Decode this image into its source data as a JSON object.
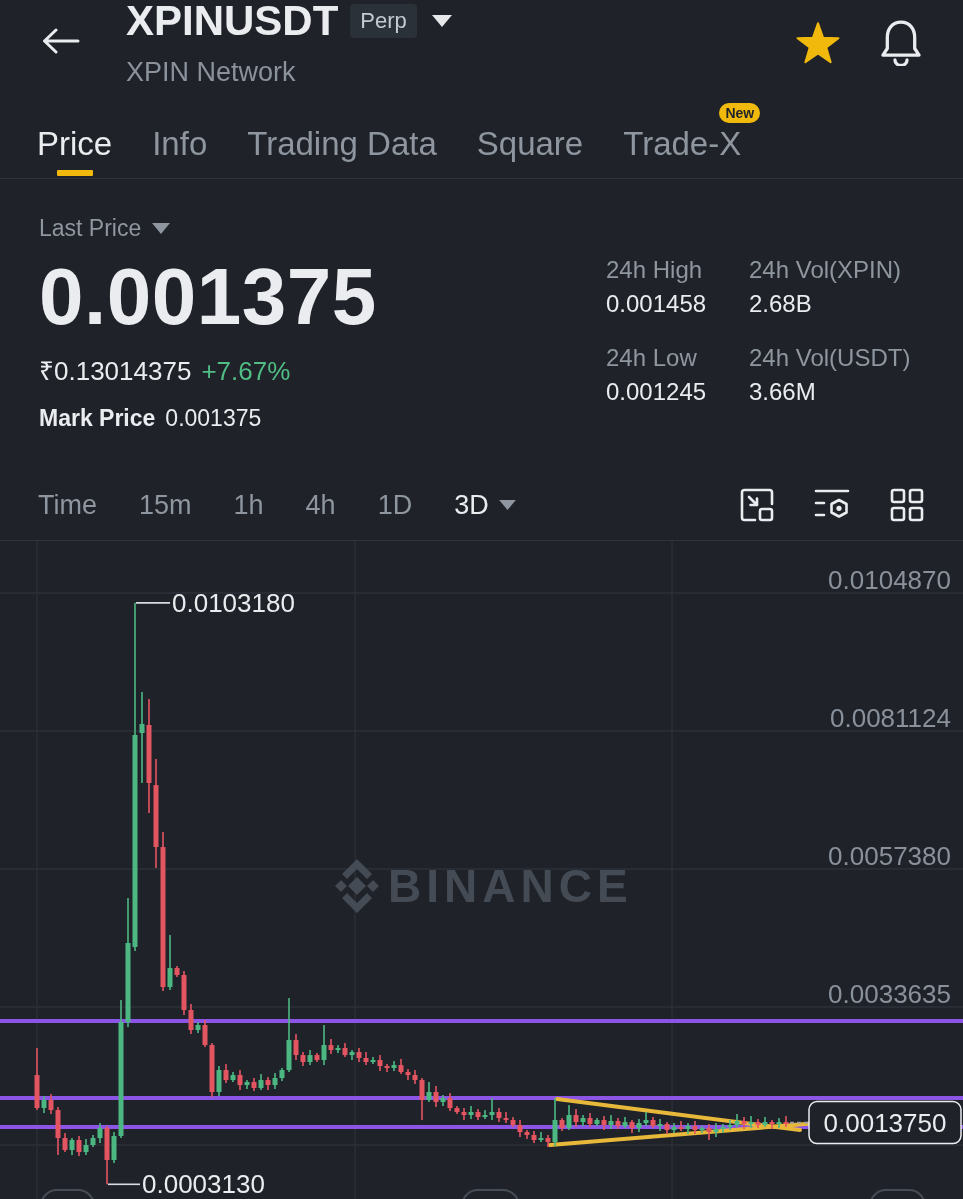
{
  "header": {
    "title": "XPINUSDT",
    "badge": "Perp",
    "subtitle": "XPIN Network",
    "favorite": true
  },
  "tabs": [
    {
      "label": "Price",
      "selected": true
    },
    {
      "label": "Info",
      "selected": false
    },
    {
      "label": "Trading Data",
      "selected": false
    },
    {
      "label": "Square",
      "selected": false
    },
    {
      "label": "Trade-X",
      "selected": false,
      "badge": "New"
    }
  ],
  "price": {
    "label": "Last Price",
    "value": "0.001375",
    "fiat": "₹0.13014375",
    "change": "+7.67%",
    "positive": true,
    "mark_label": "Mark Price",
    "mark_value": "0.001375"
  },
  "stats": [
    {
      "label": "24h High",
      "value": "0.001458"
    },
    {
      "label": "24h Vol(XPIN)",
      "value": "2.68B"
    },
    {
      "label": "24h Low",
      "value": "0.001245"
    },
    {
      "label": "24h Vol(USDT)",
      "value": "3.66M"
    }
  ],
  "intervals": [
    {
      "label": "Time",
      "selected": false,
      "dropdown": false
    },
    {
      "label": "15m",
      "selected": false,
      "dropdown": false
    },
    {
      "label": "1h",
      "selected": false,
      "dropdown": false
    },
    {
      "label": "4h",
      "selected": false,
      "dropdown": false
    },
    {
      "label": "1D",
      "selected": false,
      "dropdown": false
    },
    {
      "label": "3D",
      "selected": true,
      "dropdown": true
    }
  ],
  "chart": {
    "watermark": "BINANCE",
    "high_label": "0.0103180",
    "low_label": "0.0003130",
    "price_tag": "0.0013750",
    "chart_data": {
      "type": "candlestick",
      "grid": true,
      "ylim": [
        6e-05,
        0.011382
      ],
      "yticks": [
        {
          "value": 0.010487,
          "label": "0.0104870"
        },
        {
          "value": 0.0081124,
          "label": "0.0081124"
        },
        {
          "value": 0.005738,
          "label": "0.0057380"
        },
        {
          "value": 0.0033635,
          "label": "0.0033635"
        }
      ],
      "ref_lines": [
        {
          "axis": "y",
          "value": 0.003122
        },
        {
          "axis": "y",
          "value": 0.001797
        },
        {
          "axis": "y",
          "value": 0.001298
        }
      ],
      "categories": [
        null,
        null,
        null,
        null,
        null,
        null,
        null,
        null,
        null,
        null,
        null,
        null,
        null,
        null,
        null,
        null,
        null,
        null,
        null,
        null,
        null,
        null,
        null,
        null,
        null,
        null,
        null,
        null,
        null,
        null,
        null,
        null,
        null,
        null,
        null,
        null,
        null,
        null,
        null,
        null,
        null,
        null,
        null,
        null,
        null,
        null,
        null,
        null,
        null,
        null,
        null,
        null,
        null,
        null,
        null,
        null,
        null,
        null,
        null,
        null,
        null,
        null,
        null,
        null,
        null,
        null,
        null,
        null,
        null,
        null,
        null,
        null,
        null,
        null,
        null,
        null,
        null,
        null,
        null,
        null,
        null,
        null,
        null,
        null,
        null,
        null,
        null,
        null,
        null,
        null,
        null,
        null,
        null,
        null,
        null,
        null,
        null,
        null,
        null,
        null,
        null,
        null,
        null,
        null,
        null,
        null,
        null,
        null
      ],
      "ohlc": [
        [
          0.002193,
          0.002658,
          0.001591,
          0.001625
        ],
        [
          0.001625,
          0.001832,
          0.001539,
          0.001763
        ],
        [
          0.001763,
          0.001866,
          0.001522,
          0.001591
        ],
        [
          0.001591,
          0.001643,
          0.000817,
          0.001109
        ],
        [
          0.001109,
          0.001195,
          0.000868,
          0.000903
        ],
        [
          0.000903,
          0.001109,
          0.000817,
          0.001075
        ],
        [
          0.001075,
          0.001144,
          0.000799,
          0.000868
        ],
        [
          0.000868,
          0.001092,
          0.000817,
          0.000989
        ],
        [
          0.000989,
          0.001161,
          0.000954,
          0.001109
        ],
        [
          0.001109,
          0.001367,
          0.001023,
          0.001281
        ],
        [
          0.001281,
          0.001316,
          0.000313,
          0.000731
        ],
        [
          0.000731,
          0.001212,
          0.000679,
          0.001144
        ],
        [
          0.001144,
          0.003484,
          0.001109,
          0.003105
        ],
        [
          0.003105,
          0.005239,
          0.003019,
          0.004465
        ],
        [
          0.004396,
          0.010318,
          0.004327,
          0.008044
        ],
        [
          0.008078,
          0.008784,
          0.007218,
          0.008233
        ],
        [
          0.008216,
          0.008663,
          0.006701,
          0.007218
        ],
        [
          0.007183,
          0.007631,
          0.005755,
          0.006116
        ],
        [
          0.006116,
          0.006375,
          0.003639,
          0.003707
        ],
        [
          0.003707,
          0.004602,
          0.003656,
          0.004034
        ],
        [
          0.004034,
          0.004069,
          0.00388,
          0.003914
        ],
        [
          0.003914,
          0.003983,
          0.003226,
          0.003312
        ],
        [
          0.003312,
          0.003415,
          0.002899,
          0.002968
        ],
        [
          0.002968,
          0.003105,
          0.002916,
          0.003054
        ],
        [
          0.003054,
          0.00314,
          0.002675,
          0.002709
        ],
        [
          0.002709,
          0.002744,
          0.001815,
          0.001901
        ],
        [
          0.001901,
          0.002348,
          0.001832,
          0.002279
        ],
        [
          0.002279,
          0.002383,
          0.002056,
          0.002107
        ],
        [
          0.002107,
          0.002245,
          0.002073,
          0.002193
        ],
        [
          0.002193,
          0.002279,
          0.001935,
          0.002021
        ],
        [
          0.002021,
          0.002107,
          0.001952,
          0.002073
        ],
        [
          0.002073,
          0.002142,
          0.001918,
          0.00197
        ],
        [
          0.00197,
          0.00221,
          0.001935,
          0.002107
        ],
        [
          0.002107,
          0.002159,
          0.001935,
          0.002021
        ],
        [
          0.002021,
          0.002228,
          0.001952,
          0.002142
        ],
        [
          0.002142,
          0.002314,
          0.00209,
          0.002279
        ],
        [
          0.002279,
          0.003518,
          0.002245,
          0.002795
        ],
        [
          0.002795,
          0.002899,
          0.002451,
          0.002537
        ],
        [
          0.002537,
          0.002589,
          0.002348,
          0.002417
        ],
        [
          0.002417,
          0.002623,
          0.002365,
          0.002537
        ],
        [
          0.002537,
          0.002572,
          0.002417,
          0.002451
        ],
        [
          0.002451,
          0.003054,
          0.002365,
          0.002709
        ],
        [
          0.002709,
          0.002813,
          0.002555,
          0.002623
        ],
        [
          0.002623,
          0.002709,
          0.002572,
          0.002658
        ],
        [
          0.002658,
          0.002744,
          0.002503,
          0.002537
        ],
        [
          0.002537,
          0.002623,
          0.002451,
          0.002589
        ],
        [
          0.002589,
          0.002658,
          0.002417,
          0.002486
        ],
        [
          0.002486,
          0.002589,
          0.002365,
          0.002417
        ],
        [
          0.002417,
          0.002503,
          0.002383,
          0.002451
        ],
        [
          0.002451,
          0.002537,
          0.002262,
          0.002348
        ],
        [
          0.002348,
          0.002383,
          0.002245,
          0.002314
        ],
        [
          0.002314,
          0.002434,
          0.002262,
          0.002365
        ],
        [
          0.002365,
          0.002469,
          0.00221,
          0.002245
        ],
        [
          0.002245,
          0.002296,
          0.002107,
          0.002193
        ],
        [
          0.002193,
          0.002279,
          0.002038,
          0.002107
        ],
        [
          0.002107,
          0.002142,
          0.001419,
          0.001763
        ],
        [
          0.001763,
          0.002073,
          0.001729,
          0.001901
        ],
        [
          0.001901,
          0.002004,
          0.001643,
          0.001729
        ],
        [
          0.001729,
          0.001849,
          0.00166,
          0.001797
        ],
        [
          0.001797,
          0.001883,
          0.001574,
          0.001625
        ],
        [
          0.001625,
          0.00166,
          0.001522,
          0.001557
        ],
        [
          0.001557,
          0.001625,
          0.001419,
          0.001505
        ],
        [
          0.001505,
          0.00166,
          0.001436,
          0.001557
        ],
        [
          0.001557,
          0.001608,
          0.001419,
          0.001471
        ],
        [
          0.001471,
          0.001591,
          0.001436,
          0.001505
        ],
        [
          0.001505,
          0.001797,
          0.001419,
          0.001557
        ],
        [
          0.001557,
          0.001625,
          0.001384,
          0.001453
        ],
        [
          0.001453,
          0.001557,
          0.001367,
          0.001419
        ],
        [
          0.001419,
          0.001471,
          0.001298,
          0.001333
        ],
        [
          0.001333,
          0.001419,
          0.001126,
          0.001212
        ],
        [
          0.001212,
          0.001247,
          0.001092,
          0.001161
        ],
        [
          0.001161,
          0.00123,
          0.001023,
          0.001075
        ],
        [
          0.001075,
          0.001212,
          0.00104,
          0.001109
        ],
        [
          0.001109,
          0.001161,
          0.000954,
          0.00104
        ],
        [
          0.00104,
          0.001797,
          0.000972,
          0.001419
        ],
        [
          0.001419,
          0.001453,
          0.00123,
          0.001281
        ],
        [
          0.001281,
          0.001677,
          0.001247,
          0.001505
        ],
        [
          0.001505,
          0.001608,
          0.001298,
          0.001384
        ],
        [
          0.001384,
          0.001505,
          0.001316,
          0.001453
        ],
        [
          0.001453,
          0.001539,
          0.001298,
          0.00135
        ],
        [
          0.00135,
          0.001453,
          0.001316,
          0.001419
        ],
        [
          0.001419,
          0.001488,
          0.001247,
          0.001333
        ],
        [
          0.001333,
          0.001505,
          0.001264,
          0.001402
        ],
        [
          0.001402,
          0.001453,
          0.001264,
          0.001316
        ],
        [
          0.001316,
          0.001471,
          0.001281,
          0.001384
        ],
        [
          0.001384,
          0.001419,
          0.001195,
          0.001281
        ],
        [
          0.001281,
          0.001436,
          0.001212,
          0.001367
        ],
        [
          0.001367,
          0.001557,
          0.001316,
          0.001419
        ],
        [
          0.001419,
          0.001471,
          0.001281,
          0.001316
        ],
        [
          0.001316,
          0.001436,
          0.00123,
          0.00135
        ],
        [
          0.00135,
          0.001384,
          0.001178,
          0.001247
        ],
        [
          0.001247,
          0.001367,
          0.001195,
          0.001298
        ],
        [
          0.001298,
          0.001402,
          0.00123,
          0.001264
        ],
        [
          0.001264,
          0.001367,
          0.001178,
          0.001316
        ],
        [
          0.001316,
          0.001402,
          0.001178,
          0.001247
        ],
        [
          0.001247,
          0.001316,
          0.001195,
          0.001281
        ],
        [
          0.001281,
          0.00135,
          0.001075,
          0.001212
        ],
        [
          0.001212,
          0.001367,
          0.001126,
          0.001264
        ],
        [
          0.001264,
          0.00135,
          0.001195,
          0.001298
        ],
        [
          0.001298,
          0.001419,
          0.001247,
          0.001333
        ],
        [
          0.001333,
          0.001522,
          0.001298,
          0.001402
        ],
        [
          0.001402,
          0.001471,
          0.001264,
          0.00135
        ],
        [
          0.00135,
          0.001488,
          0.001281,
          0.001384
        ],
        [
          0.001384,
          0.001436,
          0.001281,
          0.001333
        ],
        [
          0.001333,
          0.001471,
          0.001298,
          0.001384
        ],
        [
          0.001384,
          0.001419,
          0.001264,
          0.00135
        ],
        [
          0.00135,
          0.001453,
          0.001281,
          0.001384
        ],
        [
          0.001384,
          0.001488,
          0.001298,
          0.001375
        ]
      ]
    }
  }
}
